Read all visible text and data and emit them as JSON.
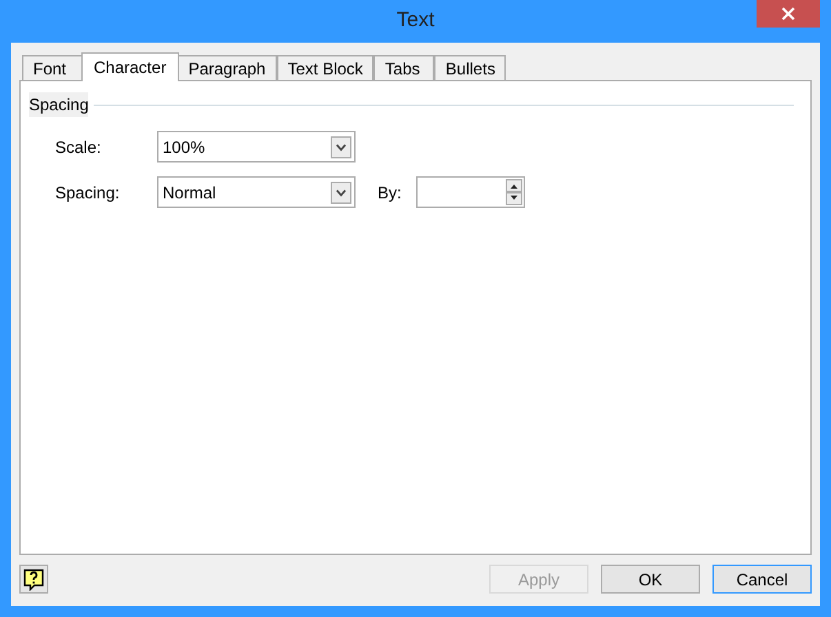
{
  "window": {
    "title": "Text"
  },
  "tabs": [
    {
      "label": "Font",
      "selected": false
    },
    {
      "label": "Character",
      "selected": true
    },
    {
      "label": "Paragraph",
      "selected": false
    },
    {
      "label": "Text Block",
      "selected": false
    },
    {
      "label": "Tabs",
      "selected": false
    },
    {
      "label": "Bullets",
      "selected": false
    }
  ],
  "group": {
    "title": "Spacing"
  },
  "fields": [
    {
      "label": "Scale:",
      "value": "100%"
    },
    {
      "label": "Spacing:",
      "value": "Normal"
    }
  ],
  "by": {
    "label": "By:"
  },
  "buttons": [
    {
      "label": "Apply",
      "disabled": true,
      "default": false
    },
    {
      "label": "OK",
      "disabled": false,
      "default": false
    },
    {
      "label": "Cancel",
      "disabled": false,
      "default": true
    }
  ]
}
